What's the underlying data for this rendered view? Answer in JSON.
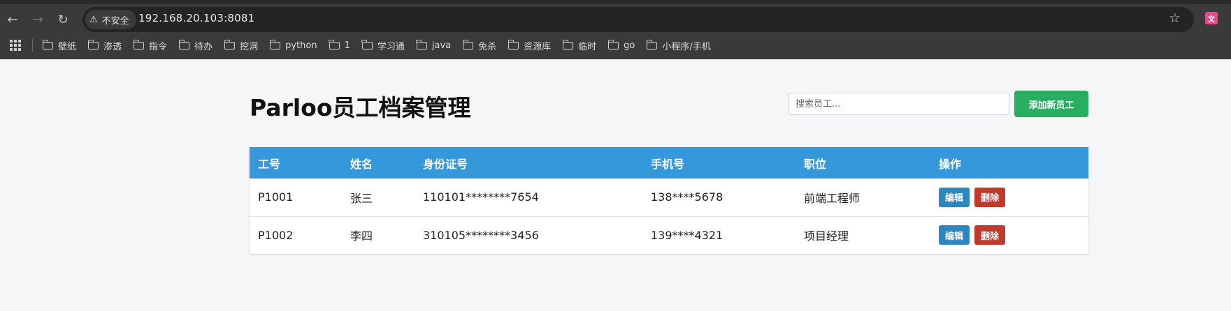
{
  "browser": {
    "security_label": "不安全",
    "url": "192.168.20.103:8081",
    "bookmarks": [
      "壁纸",
      "渗透",
      "指令",
      "待办",
      "挖洞",
      "python",
      "1",
      "学习通",
      "java",
      "免杀",
      "资源库",
      "临时",
      "go",
      "小程序/手机"
    ]
  },
  "page": {
    "title": "Parloo员工档案管理",
    "search_placeholder": "搜索员工...",
    "add_button": "添加新员工"
  },
  "table": {
    "headers": [
      "工号",
      "姓名",
      "身份证号",
      "手机号",
      "职位",
      "操作"
    ],
    "rows": [
      {
        "id": "P1001",
        "name": "张三",
        "id_card": "110101********7654",
        "phone": "138****5678",
        "position": "前端工程师"
      },
      {
        "id": "P1002",
        "name": "李四",
        "id_card": "310105********3456",
        "phone": "139****4321",
        "position": "项目经理"
      }
    ],
    "edit_label": "编辑",
    "delete_label": "删除"
  },
  "colors": {
    "header": "#3498db",
    "add": "#27ae60",
    "edit": "#2e86c1",
    "delete": "#c0392b"
  }
}
